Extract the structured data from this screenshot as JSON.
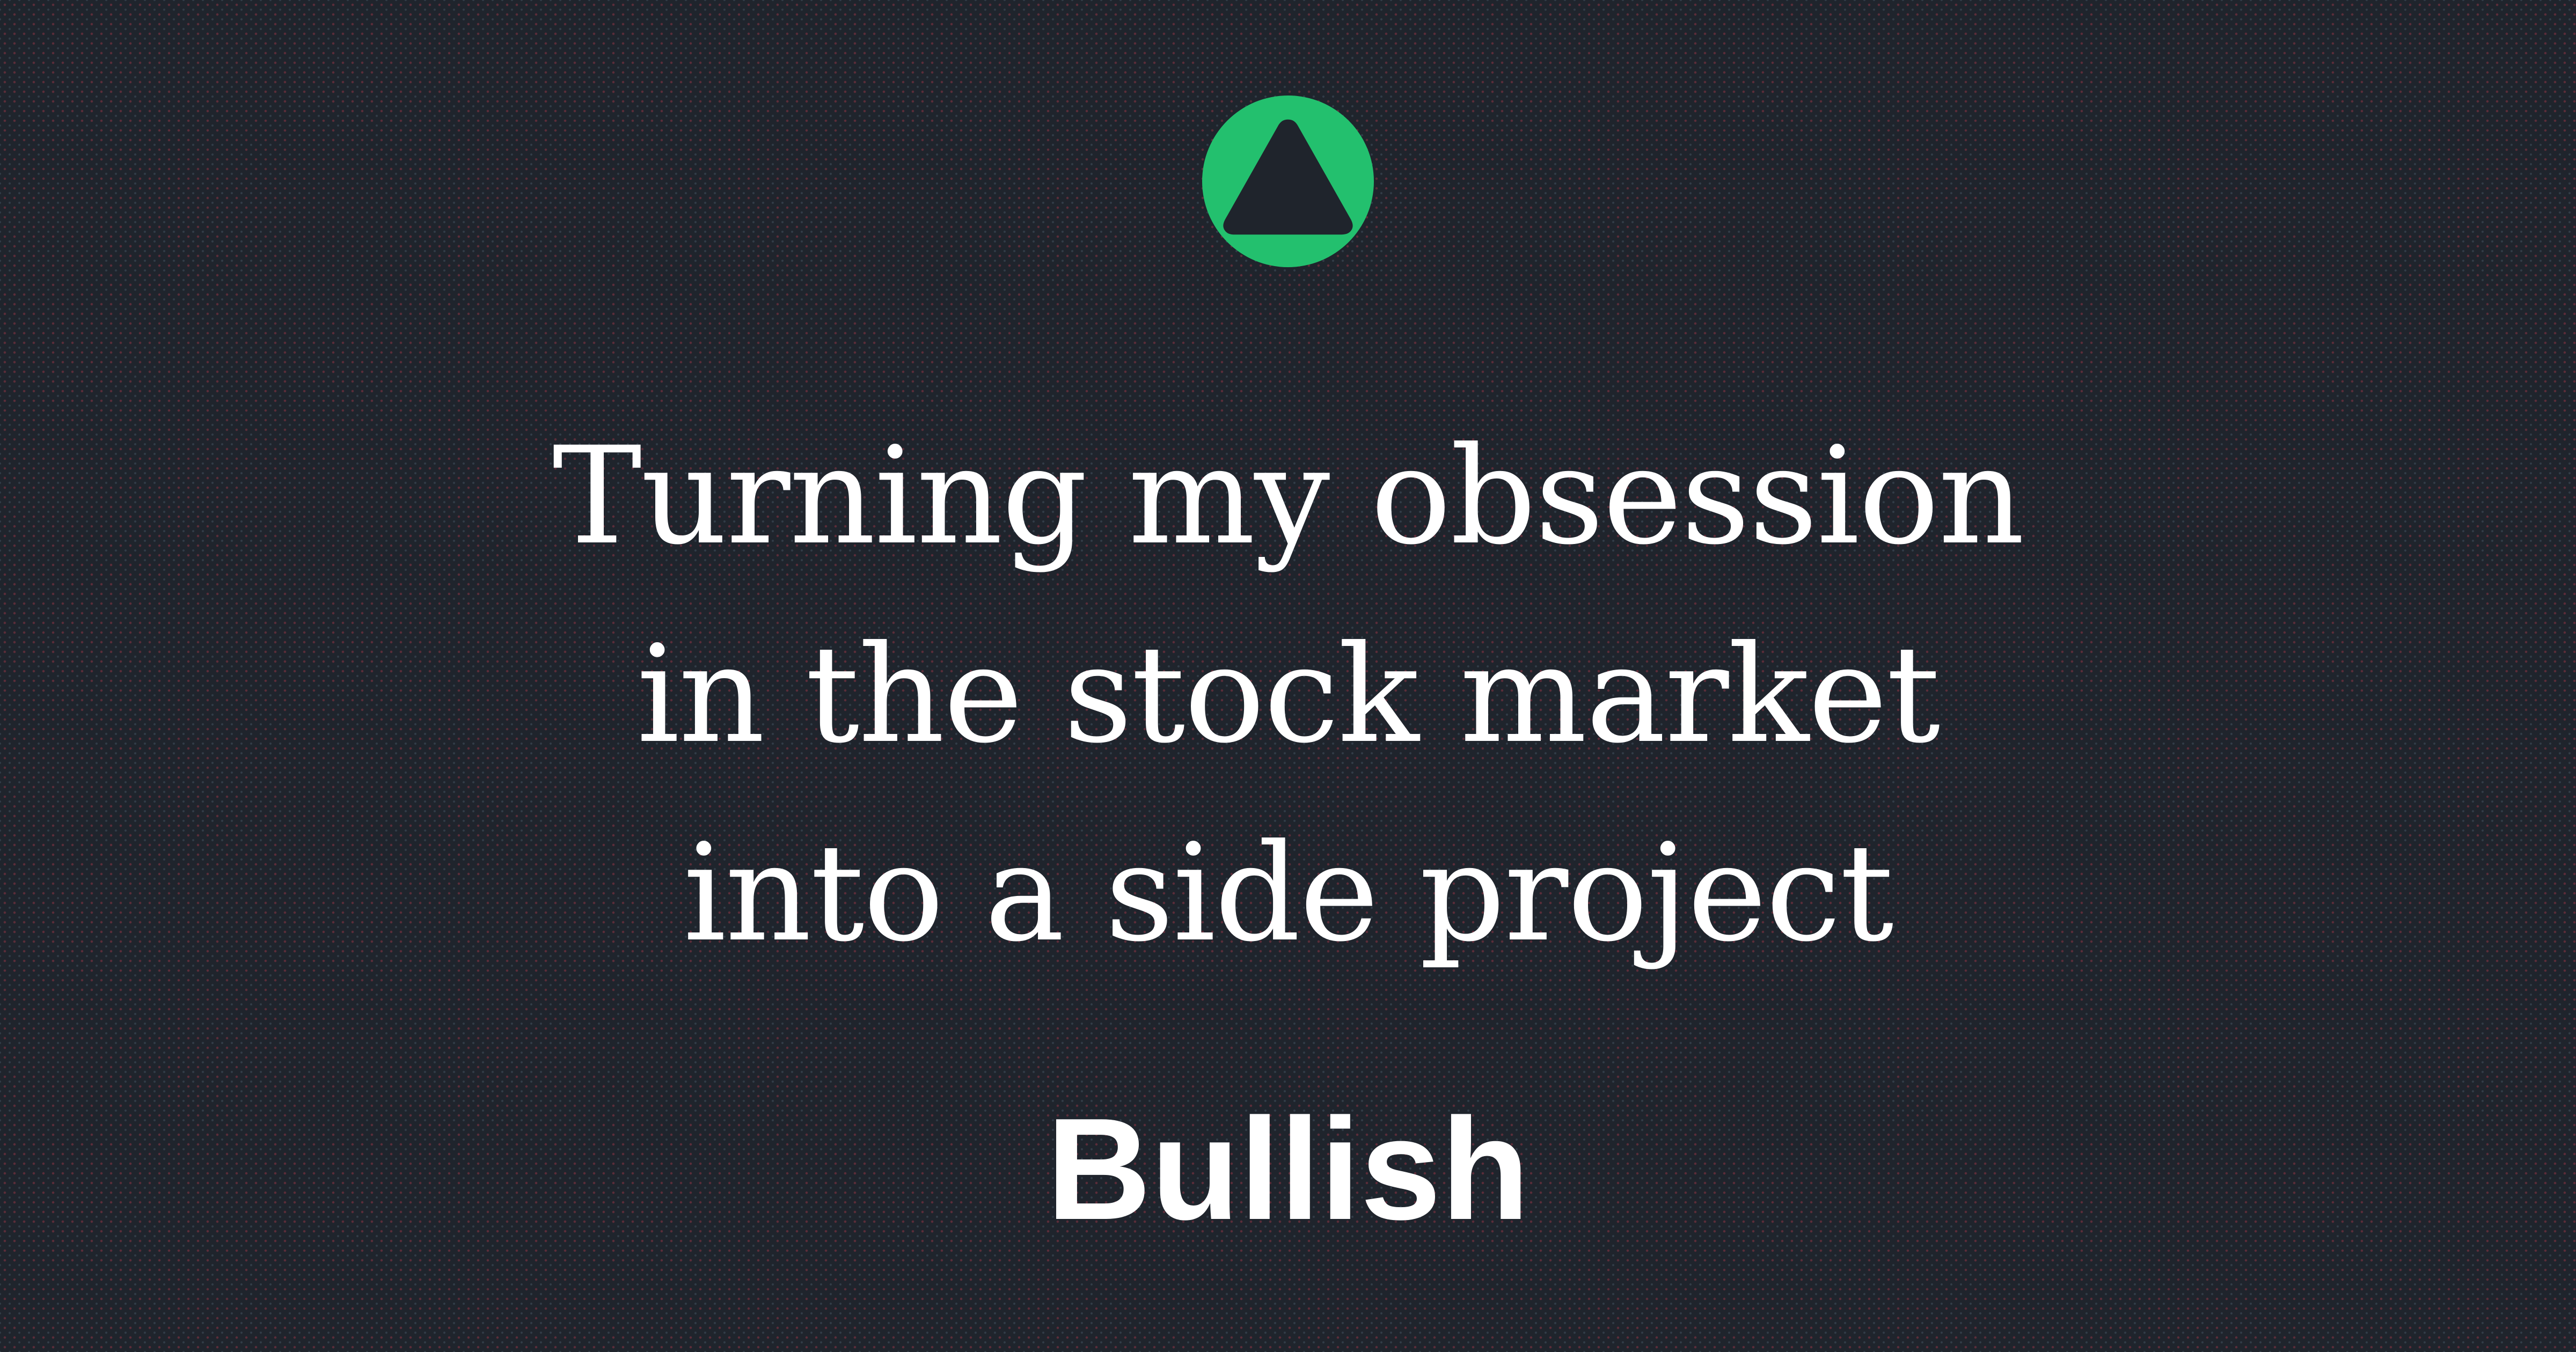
{
  "logo": {
    "icon": "up-triangle-icon",
    "circle_color": "#23c06e",
    "triangle_color": "#1f242c"
  },
  "headline": {
    "lines": [
      "Turning my obsession",
      "in the stock market",
      "into a side project"
    ]
  },
  "brand": {
    "name": "Bullish"
  },
  "colors": {
    "background": "#1f242c",
    "text": "#ffffff",
    "dot_pattern": "#be3c50"
  }
}
